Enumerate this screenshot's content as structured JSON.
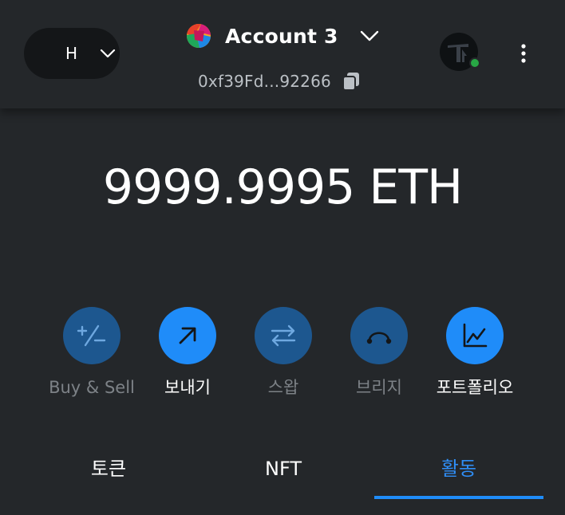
{
  "header": {
    "network": {
      "letter": "H",
      "chevron_icon": "chevron-down-icon"
    },
    "account": {
      "name": "Account 3",
      "avatar_icon": "account-jazzicon",
      "chevron_icon": "chevron-down-icon"
    },
    "address": {
      "short": "0xf39Fd...92266",
      "copy_icon": "copy-icon"
    },
    "profile_icon": "profile-avatar-icon",
    "status_color": "#28a745",
    "more_icon": "more-vertical-icon"
  },
  "balance": {
    "text": "9999.9995 ETH"
  },
  "actions": [
    {
      "label": "Buy & Sell",
      "icon": "plus-minus-icon",
      "enabled": false
    },
    {
      "label": "보내기",
      "icon": "arrow-up-right-icon",
      "enabled": true
    },
    {
      "label": "스왑",
      "icon": "swap-arrows-icon",
      "enabled": false
    },
    {
      "label": "브리지",
      "icon": "bridge-icon",
      "enabled": false
    },
    {
      "label": "포트폴리오",
      "icon": "chart-icon",
      "enabled": true
    }
  ],
  "tabs": [
    {
      "label": "토큰",
      "active": false
    },
    {
      "label": "NFT",
      "active": false
    },
    {
      "label": "활동",
      "active": true
    }
  ],
  "colors": {
    "background": "#24272a",
    "accent": "#1f8cf9",
    "accent_dim": "#1d578f",
    "muted_text": "#7d8287",
    "address_text": "#bbc0c5"
  }
}
